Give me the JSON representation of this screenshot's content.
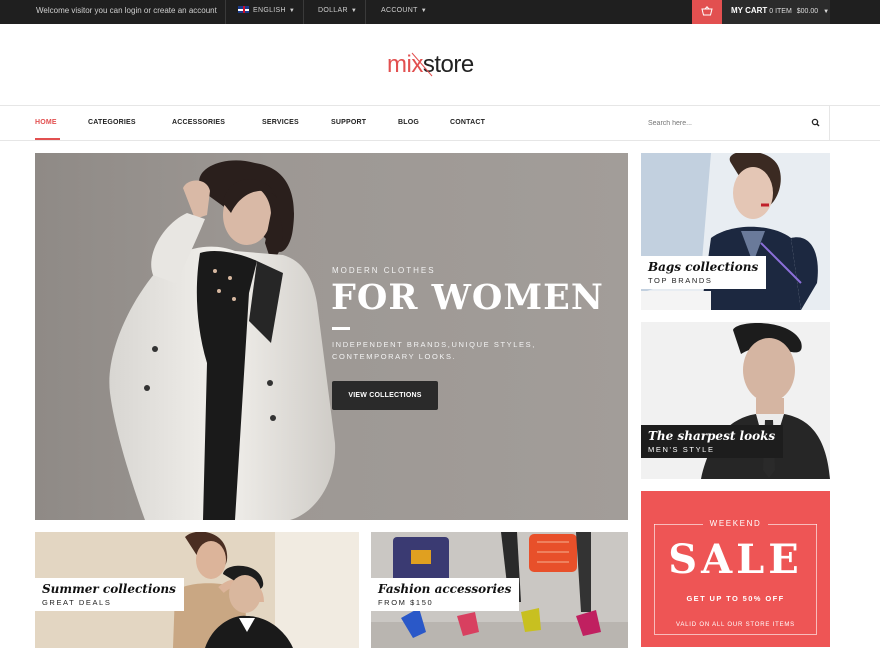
{
  "topbar": {
    "welcome": "Welcome visitor you can login or create an account",
    "language": "ENGLISH",
    "currency": "DOLLAR",
    "account": "ACCOUNT",
    "cart_label": "MY CART",
    "cart_items": "0 ITEM",
    "cart_total": "$00.00"
  },
  "logo": {
    "part1": "mix",
    "part2": "store"
  },
  "nav": {
    "items": [
      "HOME",
      "CATEGORIES",
      "ACCESSORIES",
      "SERVICES",
      "SUPPORT",
      "BLOG",
      "CONTACT"
    ],
    "search_placeholder": "Search here..."
  },
  "hero": {
    "eyebrow": "MODERN CLOTHES",
    "title": "FOR WOMEN",
    "description": "INDEPENDENT BRANDS,UNIQUE STYLES, CONTEMPORARY LOOKS.",
    "button": "VIEW COLLECTIONS"
  },
  "banners": {
    "bags": {
      "title": "Bags collections",
      "subtitle": "TOP BRANDS"
    },
    "men": {
      "title": "The sharpest looks",
      "subtitle": "MEN'S STYLE"
    },
    "summer": {
      "title": "Summer collections",
      "subtitle": "GREAT DEALS"
    },
    "fashion": {
      "title": "Fashion accessories",
      "subtitle": "FROM $150"
    }
  },
  "sale": {
    "weekend": "WEEKEND",
    "title": "SALE",
    "offer": "GET UP TO 50% OFF",
    "valid": "VALID ON ALL OUR STORE ITEMS"
  },
  "colors": {
    "accent": "#e25050",
    "topbar": "#1f1f1f",
    "sale_bg": "#ee5555"
  }
}
